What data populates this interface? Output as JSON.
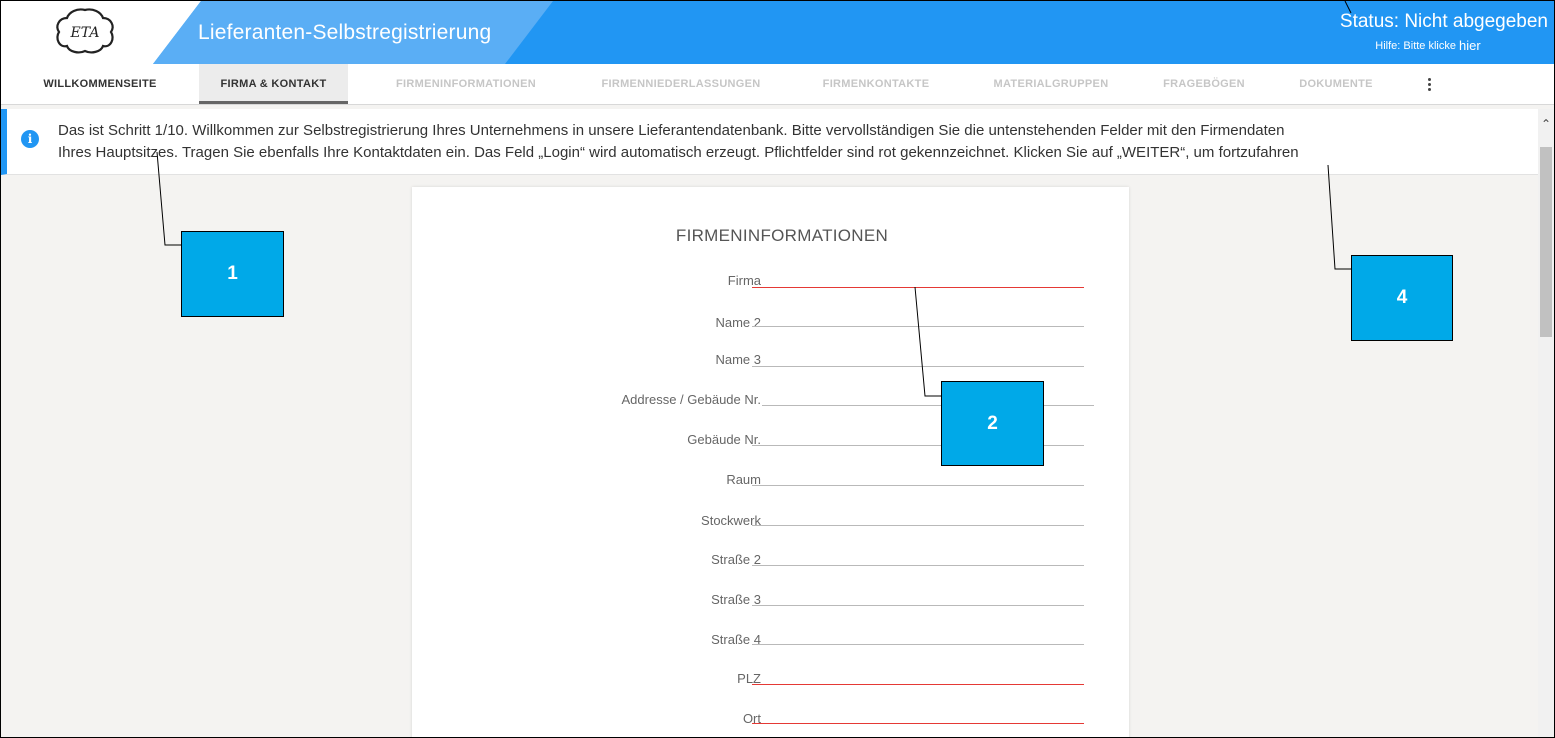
{
  "header": {
    "title": "Lieferanten-Selbstregistrierung",
    "status": "Status: Nicht abgegeben",
    "help_text": "Hilfe: Bitte klicke",
    "help_link": "hier"
  },
  "tabs": [
    {
      "label": "WILLKOMMENSEITE",
      "state": "done"
    },
    {
      "label": "FIRMA & KONTAKT",
      "state": "active"
    },
    {
      "label": "FIRMENINFORMATIONEN",
      "state": "disabled"
    },
    {
      "label": "FIRMENNIEDERLASSUNGEN",
      "state": "disabled"
    },
    {
      "label": "FIRMENKONTAKTE",
      "state": "disabled"
    },
    {
      "label": "MATERIALGRUPPEN",
      "state": "disabled"
    },
    {
      "label": "FRAGEBÖGEN",
      "state": "disabled"
    },
    {
      "label": "DOKUMENTE",
      "state": "disabled"
    }
  ],
  "info": {
    "icon": "info-icon",
    "line1": "Das ist Schritt 1/10. Willkommen zur Selbstregistrierung Ihres Unternehmens in unsere Lieferantendatenbank. Bitte vervollständigen Sie die untenstehenden Felder mit den Firmendaten",
    "line2": "Ihres Hauptsitzes. Tragen Sie ebenfalls Ihre Kontaktdaten ein. Das Feld „Login“ wird automatisch erzeugt. Pflichtfelder sind rot gekennzeichnet. Klicken Sie auf „WEITER“, um fortzufahren"
  },
  "form": {
    "title": "FIRMENINFORMATIONEN",
    "fields": [
      {
        "label": "Firma",
        "required": true,
        "value": ""
      },
      {
        "label": "Name 2",
        "required": false,
        "value": ""
      },
      {
        "label": "Name 3",
        "required": false,
        "value": ""
      },
      {
        "label": "Addresse / Gebäude Nr.",
        "required": false,
        "value": ""
      },
      {
        "label": "Gebäude Nr.",
        "required": false,
        "value": ""
      },
      {
        "label": "Raum",
        "required": false,
        "value": ""
      },
      {
        "label": "Stockwerk",
        "required": false,
        "value": ""
      },
      {
        "label": "Straße 2",
        "required": false,
        "value": ""
      },
      {
        "label": "Straße 3",
        "required": false,
        "value": ""
      },
      {
        "label": "Straße 4",
        "required": false,
        "value": ""
      },
      {
        "label": "PLZ",
        "required": true,
        "value": ""
      },
      {
        "label": "Ort",
        "required": true,
        "value": ""
      }
    ]
  },
  "callouts": [
    "1",
    "2",
    "4"
  ],
  "colors": {
    "primary": "#2196f3",
    "primary_light": "#5aaef5",
    "required": "#e53935",
    "callout": "#00a9e8"
  }
}
